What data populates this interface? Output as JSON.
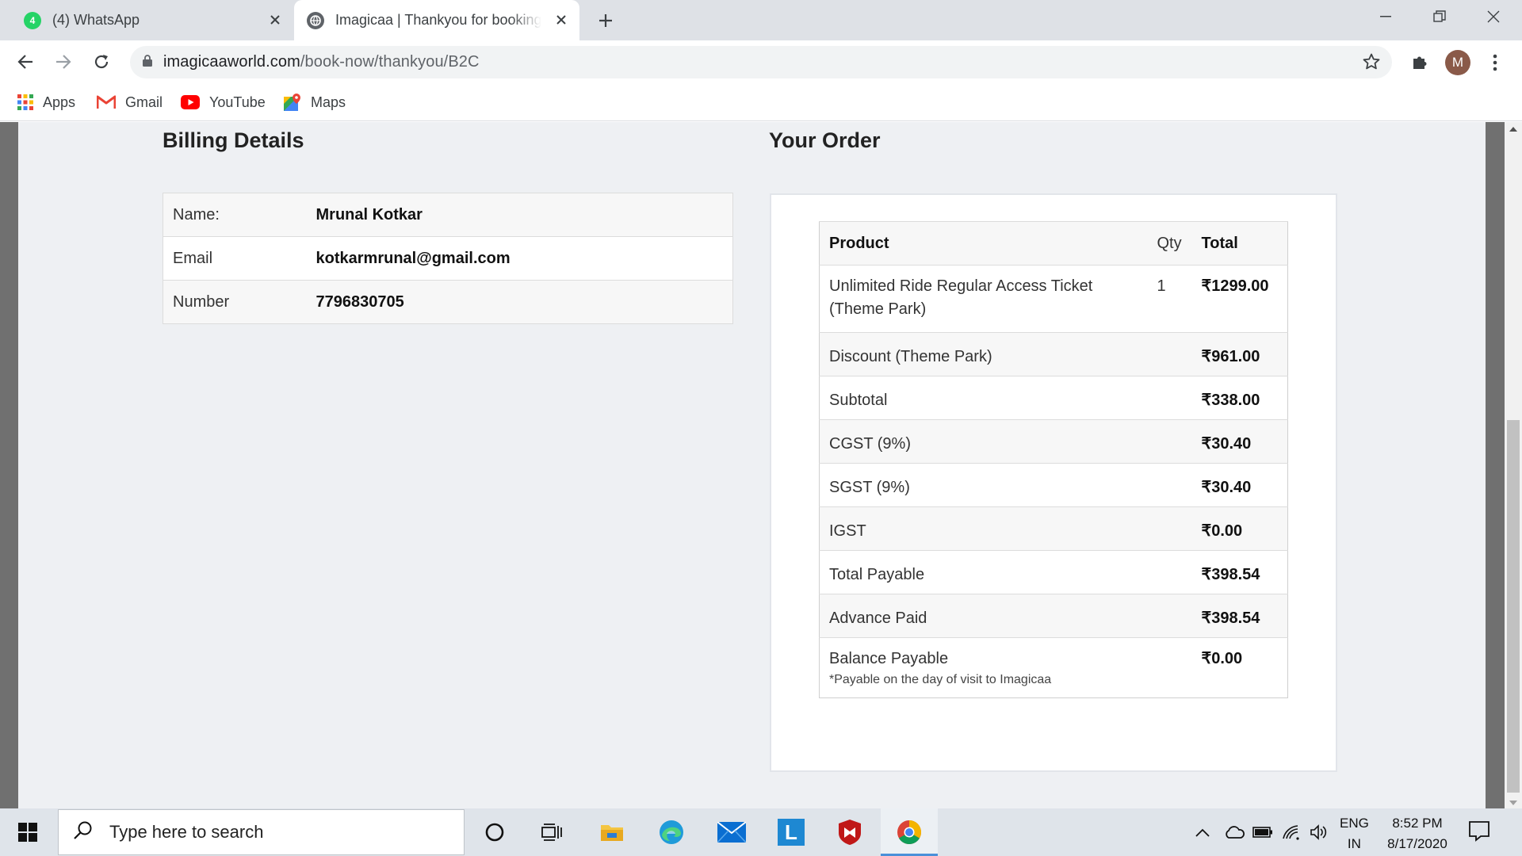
{
  "browser": {
    "tabs": [
      {
        "title": "(4) WhatsApp",
        "badge": "4"
      },
      {
        "title": "Imagicaa | Thankyou for booking"
      }
    ],
    "url_host": "imagicaaworld.com",
    "url_path": "/book-now/thankyou/B2C",
    "profile_initial": "M",
    "bookmarks": [
      "Apps",
      "Gmail",
      "YouTube",
      "Maps"
    ]
  },
  "billing": {
    "title": "Billing Details",
    "rows": [
      {
        "label": "Name:",
        "value": "Mrunal Kotkar"
      },
      {
        "label": "Email",
        "value": "kotkarmrunal@gmail.com"
      },
      {
        "label": "Number",
        "value": "7796830705"
      }
    ]
  },
  "order": {
    "title": "Your Order",
    "headers": {
      "product": "Product",
      "qty": "Qty",
      "total": "Total"
    },
    "rows": [
      {
        "label": "Unlimited Ride Regular Access Ticket (Theme Park)",
        "qty": "1",
        "amount": "₹1299.00"
      },
      {
        "label": "Discount (Theme Park)",
        "qty": "",
        "amount": "₹961.00"
      },
      {
        "label": "Subtotal",
        "qty": "",
        "amount": "₹338.00"
      },
      {
        "label": "CGST (9%)",
        "qty": "",
        "amount": "₹30.40"
      },
      {
        "label": "SGST (9%)",
        "qty": "",
        "amount": "₹30.40"
      },
      {
        "label": "IGST",
        "qty": "",
        "amount": "₹0.00"
      },
      {
        "label": "Total Payable",
        "qty": "",
        "amount": "₹398.54"
      },
      {
        "label": "Advance Paid",
        "qty": "",
        "amount": "₹398.54"
      },
      {
        "label": "Balance Payable",
        "qty": "",
        "amount": "₹0.00",
        "note": "*Payable on the day of visit to Imagicaa"
      }
    ]
  },
  "taskbar": {
    "search_placeholder": "Type here to search",
    "lang_line1": "ENG",
    "lang_line2": "IN",
    "time": "8:52 PM",
    "date": "8/17/2020",
    "launcher_letter": "L"
  },
  "colors": {
    "accent": "#4a90d9",
    "whatsapp": "#25d366",
    "gmail_red": "#ea4335",
    "youtube_red": "#ff0000",
    "mcafee_red": "#c01818"
  }
}
